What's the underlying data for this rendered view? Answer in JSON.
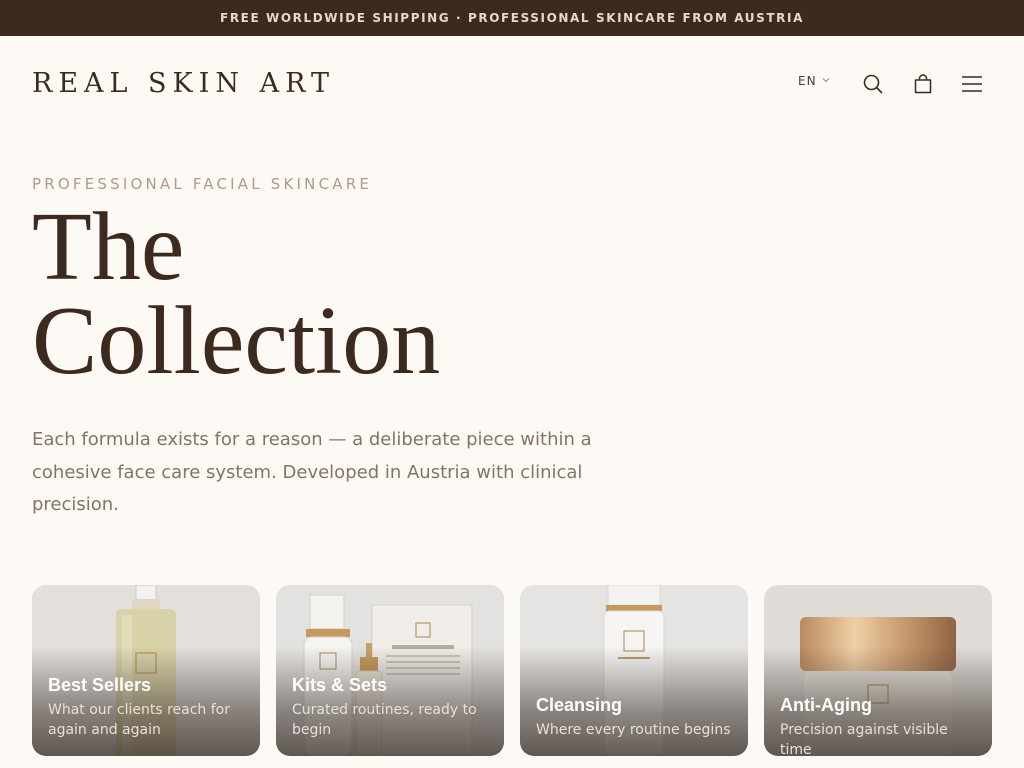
{
  "announcement": "FREE WORLDWIDE SHIPPING · PROFESSIONAL SKINCARE FROM AUSTRIA",
  "header": {
    "logo": "REAL SKIN ART",
    "language": "EN",
    "icons": [
      "chevron-down-icon",
      "search-icon",
      "shopping-bag-icon",
      "menu-icon"
    ]
  },
  "hero": {
    "eyebrow": "PROFESSIONAL FACIAL SKINCARE",
    "title_line1": "The",
    "title_line2": "Collection",
    "description": "Each formula exists for a reason — a deliberate piece within a cohesive face care system. Developed in Austria with clinical precision."
  },
  "categories": [
    {
      "title": "Best Sellers",
      "subtitle": "What our clients reach for again and again"
    },
    {
      "title": "Kits & Sets",
      "subtitle": "Curated routines, ready to begin"
    },
    {
      "title": "Cleansing",
      "subtitle": "Where every routine begins"
    },
    {
      "title": "Anti-Aging",
      "subtitle": "Precision against visible time"
    }
  ],
  "colors": {
    "announcement_bg": "#3d2a1e",
    "page_bg": "#fdf9f5",
    "text_dark": "#3d2a1e",
    "accent_muted": "#b19a85",
    "body_text": "#847468"
  }
}
